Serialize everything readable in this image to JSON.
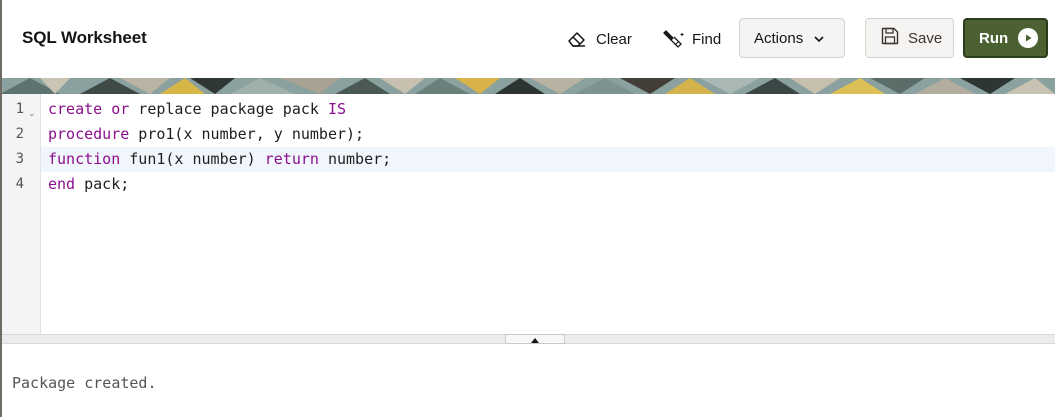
{
  "header": {
    "title": "SQL Worksheet",
    "clear_label": "Clear",
    "find_label": "Find",
    "actions_label": "Actions",
    "save_label": "Save",
    "run_label": "Run"
  },
  "colors": {
    "run_button": "#4c6132",
    "keyword": "#8b0e8f",
    "active_line": "#f0f6fb"
  },
  "icons": {
    "clear": "eraser-icon",
    "find": "flashlight-icon",
    "actions": "chevron-down-icon",
    "save": "floppy-disk-icon",
    "run": "play-circle-icon",
    "fold": "fold-arrow-icon"
  },
  "editor": {
    "active_line": 3,
    "lines": [
      {
        "number": "1",
        "tokens": [
          {
            "t": "create",
            "kw": true
          },
          {
            "t": " "
          },
          {
            "t": "or",
            "kw": true
          },
          {
            "t": " replace package pack "
          },
          {
            "t": "IS",
            "kw": true
          }
        ]
      },
      {
        "number": "2",
        "tokens": [
          {
            "t": "procedure",
            "kw": true
          },
          {
            "t": " pro1(x number, y number);"
          }
        ]
      },
      {
        "number": "3",
        "tokens": [
          {
            "t": "function",
            "kw": true
          },
          {
            "t": " fun1(x number) "
          },
          {
            "t": "return",
            "kw": true
          },
          {
            "t": " number;"
          }
        ]
      },
      {
        "number": "4",
        "tokens": [
          {
            "t": "end",
            "kw": true
          },
          {
            "t": " pack;"
          }
        ]
      }
    ]
  },
  "output": {
    "text": "Package created."
  }
}
